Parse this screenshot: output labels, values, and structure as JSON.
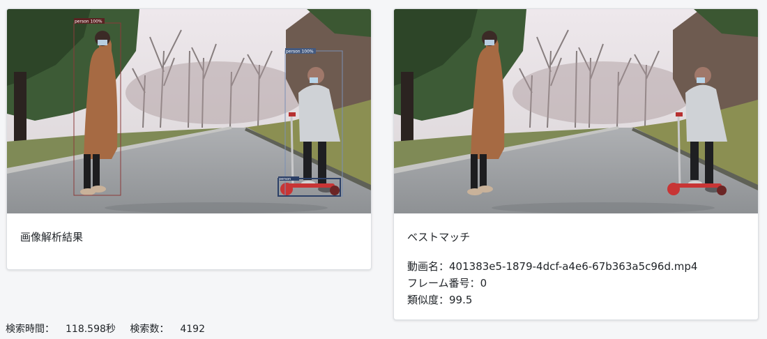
{
  "analysis_card": {
    "title": "画像解析結果",
    "detections": [
      {
        "label": "person 100%"
      },
      {
        "label": "person 100%"
      },
      {
        "label": "person"
      }
    ]
  },
  "best_match_card": {
    "title": "ベストマッチ",
    "video_name_label": "動画名：",
    "video_name": "401383e5-1879-4dcf-a4e6-67b363a5c96d.mp4",
    "frame_label": "フレーム番号：",
    "frame_number": "0",
    "similarity_label": "類似度：",
    "similarity": "99.5"
  },
  "footer": {
    "search_time_label": "検索時間：",
    "search_time": "118.598秒",
    "search_count_label": "検索数：",
    "search_count": "4192"
  },
  "colors": {
    "bbox_woman": "#8b3a3a",
    "bbox_child": "#7a8fb5",
    "bbox_scooter": "#2b3f66"
  }
}
